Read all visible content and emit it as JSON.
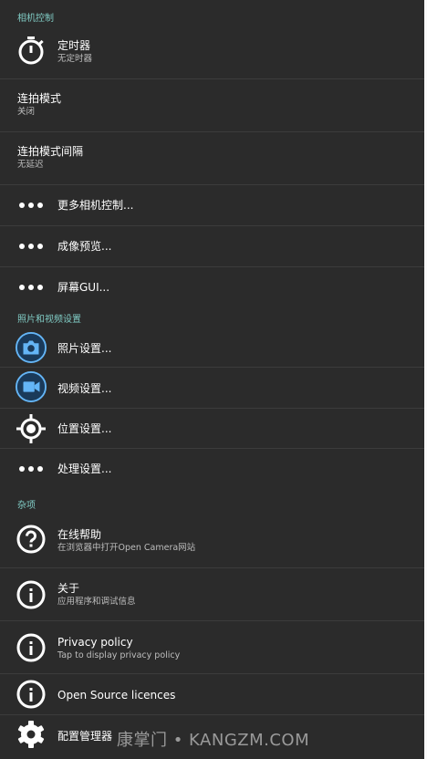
{
  "sections": {
    "camera_controls": "相机控制",
    "photo_video": "照片和视频设置",
    "misc": "杂项"
  },
  "items": {
    "timer": {
      "title": "定时器",
      "sub": "无定时器",
      "icon": "timer-icon"
    },
    "burst_mode": {
      "title": "连拍模式",
      "sub": "关闭"
    },
    "burst_interval": {
      "title": "连拍模式间隔",
      "sub": "无延迟"
    },
    "more_camera_controls": {
      "title": "更多相机控制...",
      "icon": "more-dots-icon"
    },
    "preview": {
      "title": "成像预览...",
      "icon": "more-dots-icon"
    },
    "on_screen_gui": {
      "title": "屏幕GUI...",
      "icon": "more-dots-icon"
    },
    "photo_settings": {
      "title": "照片设置...",
      "icon": "camera-icon"
    },
    "video_settings": {
      "title": "视频设置...",
      "icon": "video-camera-icon"
    },
    "location_settings": {
      "title": "位置设置...",
      "icon": "gps-location-icon"
    },
    "processing_settings": {
      "title": "处理设置...",
      "icon": "more-dots-icon"
    },
    "online_help": {
      "title": "在线帮助",
      "sub": "在浏览器中打开Open Camera网站",
      "icon": "help-icon"
    },
    "about": {
      "title": "关于",
      "sub": "应用程序和调试信息",
      "icon": "info-icon"
    },
    "privacy_policy": {
      "title": "Privacy policy",
      "sub": "Tap to display privacy policy",
      "icon": "info-icon"
    },
    "open_source": {
      "title": "Open Source licences",
      "icon": "info-icon"
    },
    "config_manager": {
      "title": "配置管理器",
      "icon": "gear-icon"
    }
  },
  "watermark": "康掌门 • KANGZM.COM",
  "colors": {
    "accent": "#80cbc4",
    "background": "#2b2b2b",
    "icon_blue": "#64b5f6"
  }
}
